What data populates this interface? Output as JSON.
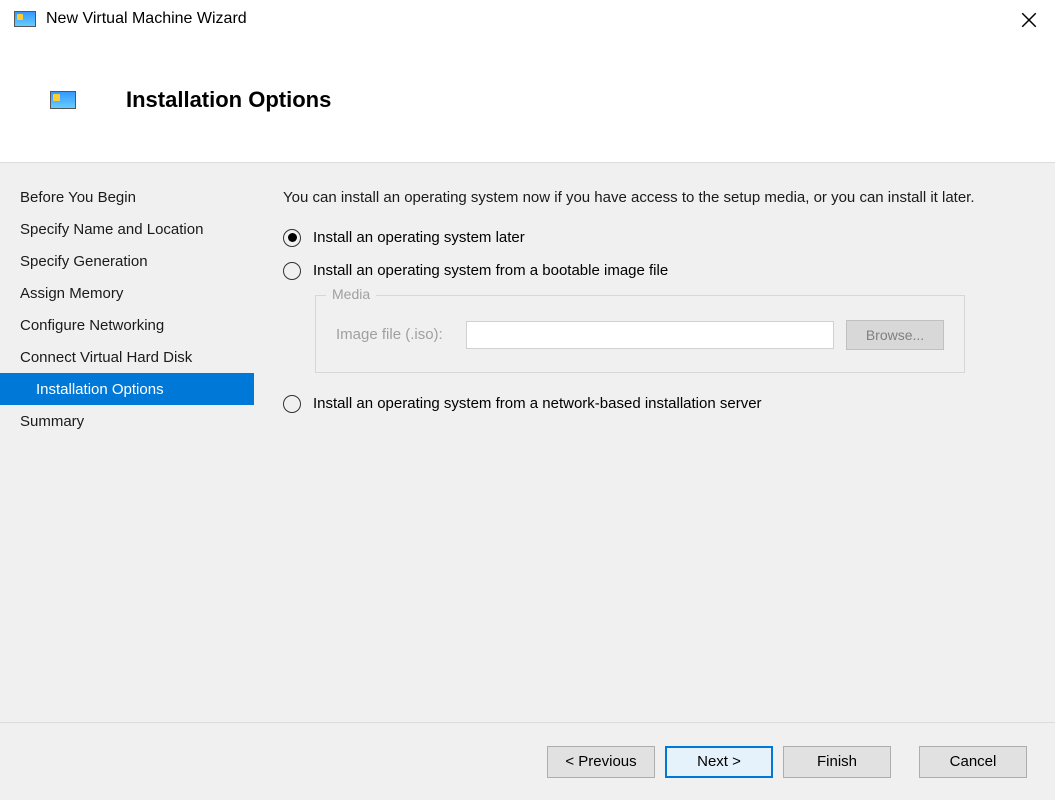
{
  "titlebar": {
    "title": "New Virtual Machine Wizard"
  },
  "header": {
    "title": "Installation Options"
  },
  "sidebar": {
    "items": [
      {
        "label": "Before You Begin",
        "selected": false
      },
      {
        "label": "Specify Name and Location",
        "selected": false
      },
      {
        "label": "Specify Generation",
        "selected": false
      },
      {
        "label": "Assign Memory",
        "selected": false
      },
      {
        "label": "Configure Networking",
        "selected": false
      },
      {
        "label": "Connect Virtual Hard Disk",
        "selected": false
      },
      {
        "label": "Installation Options",
        "selected": true
      },
      {
        "label": "Summary",
        "selected": false
      }
    ]
  },
  "content": {
    "intro": "You can install an operating system now if you have access to the setup media, or you can install it later.",
    "options": {
      "later": "Install an operating system later",
      "bootable": "Install an operating system from a bootable image file",
      "network": "Install an operating system from a network-based installation server"
    },
    "media": {
      "legend": "Media",
      "iso_label": "Image file (.iso):",
      "iso_value": "",
      "browse": "Browse..."
    }
  },
  "footer": {
    "previous": "< Previous",
    "next": "Next >",
    "finish": "Finish",
    "cancel": "Cancel"
  }
}
